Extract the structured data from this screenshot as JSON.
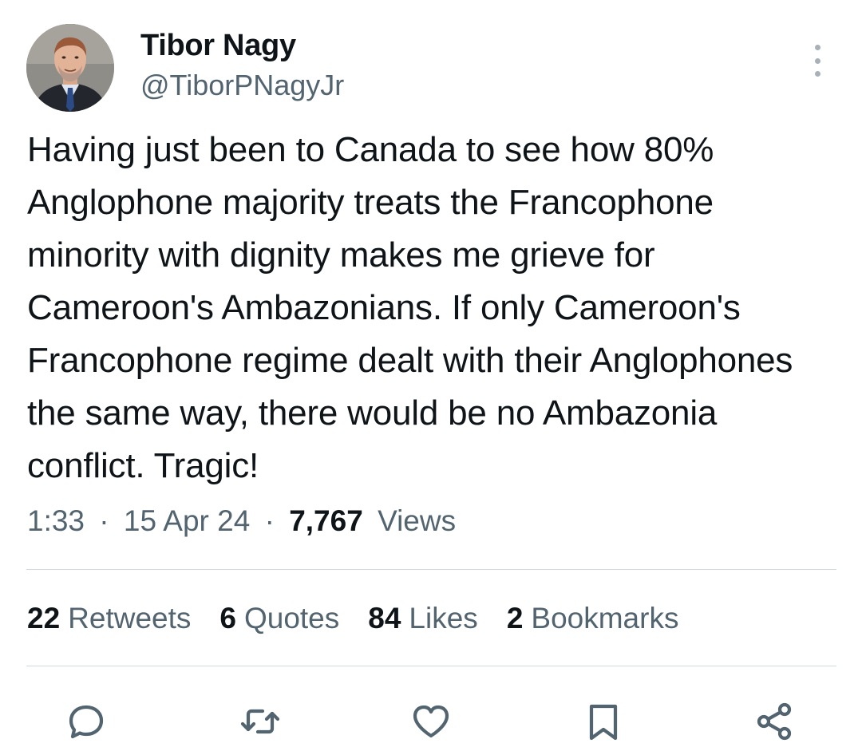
{
  "author": {
    "name": "Tibor Nagy",
    "handle": "@TiborPNagyJr"
  },
  "tweet": {
    "text": "Having just been to Canada to see how 80% Anglophone majority treats the Francophone minority with dignity makes me grieve for Cameroon's Ambazonians. If only Cameroon's Francophone regime dealt with their Anglophones the same way, there would be no Ambazonia conflict. Tragic!",
    "time": "1:33",
    "separator": "·",
    "date": "15 Apr 24",
    "views_count": "7,767",
    "views_label": "Views"
  },
  "stats": {
    "retweets": {
      "count": "22",
      "label": "Retweets"
    },
    "quotes": {
      "count": "6",
      "label": "Quotes"
    },
    "likes": {
      "count": "84",
      "label": "Likes"
    },
    "bookmarks": {
      "count": "2",
      "label": "Bookmarks"
    }
  },
  "icons": {
    "more": "more-vertical-icon",
    "reply": "reply-bubble-icon",
    "retweet": "retweet-icon",
    "like": "heart-icon",
    "bookmark": "bookmark-icon",
    "share": "share-icon"
  },
  "colors": {
    "text_primary": "#0f1419",
    "text_secondary": "#536471",
    "divider": "#cfd9de",
    "icon": "#536471"
  }
}
